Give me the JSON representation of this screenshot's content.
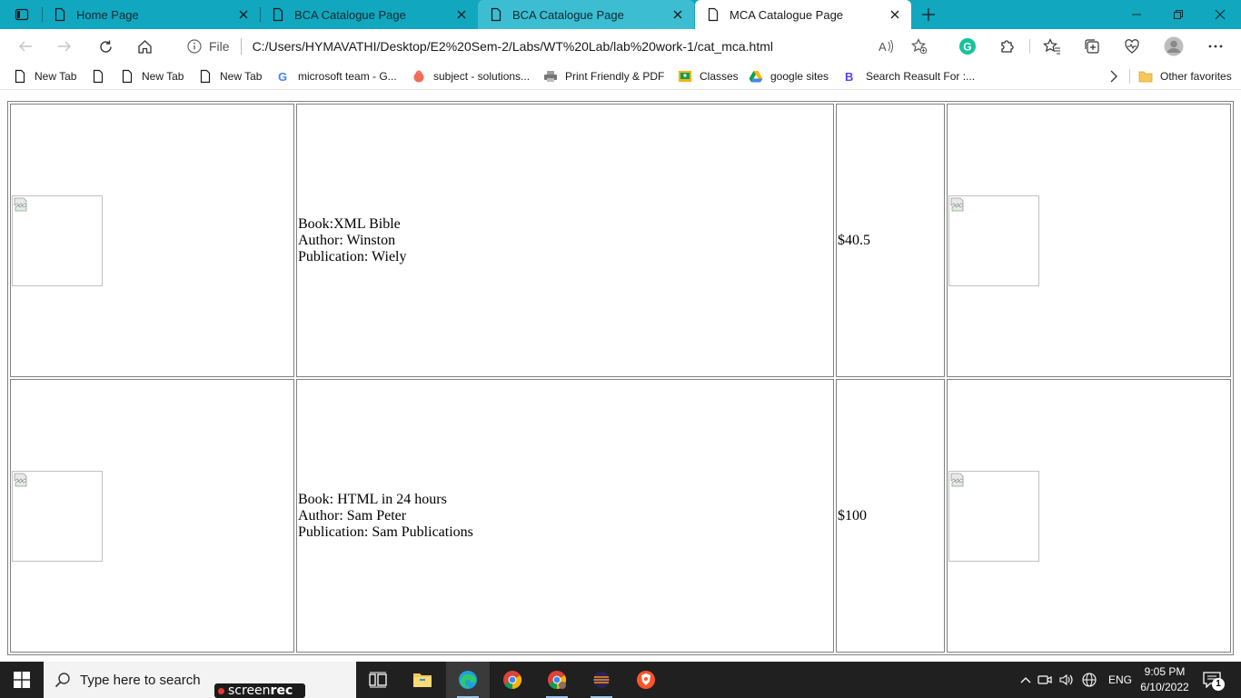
{
  "browser": {
    "tabs": [
      {
        "title": "Home Page",
        "state": "inactive"
      },
      {
        "title": "BCA Catalogue Page",
        "state": "inactive"
      },
      {
        "title": "BCA Catalogue Page",
        "state": "hover"
      },
      {
        "title": "MCA Catalogue Page",
        "state": "active"
      }
    ],
    "address": {
      "info_label": "File",
      "url": "C:/Users/HYMAVATHI/Desktop/E2%20Sem-2/Labs/WT%20Lab/lab%20work-1/cat_mca.html"
    },
    "favorites": [
      {
        "label": "New Tab",
        "icon": "page-icon"
      },
      {
        "label": "",
        "icon": "page-icon"
      },
      {
        "label": "New Tab",
        "icon": "page-icon"
      },
      {
        "label": "New Tab",
        "icon": "page-icon"
      },
      {
        "label": "microsoft team - G...",
        "icon": "google-icon"
      },
      {
        "label": "subject - solutions...",
        "icon": "solutions-icon"
      },
      {
        "label": "Print Friendly & PDF",
        "icon": "printer-icon"
      },
      {
        "label": "Classes",
        "icon": "classroom-icon"
      },
      {
        "label": "google sites",
        "icon": "drive-icon"
      },
      {
        "label": "Search Reasult For :...",
        "icon": "bing-icon"
      }
    ],
    "other_favorites": "Other favorites"
  },
  "catalogue": {
    "rows": [
      {
        "book": "Book:XML Bible",
        "author": "Author: Winston",
        "publication": "Publication: Wiely",
        "price": "$40.5"
      },
      {
        "book": "Book: HTML in 24 hours",
        "author": "Author: Sam Peter",
        "publication": "Publication: Sam Publications",
        "price": "$100"
      }
    ]
  },
  "taskbar": {
    "search_placeholder": "Type here to search",
    "screenrec_text": "screen",
    "screenrec_bold": "rec",
    "language": "ENG",
    "time": "9:05 PM",
    "date": "6/10/2022",
    "notification_count": "1"
  }
}
